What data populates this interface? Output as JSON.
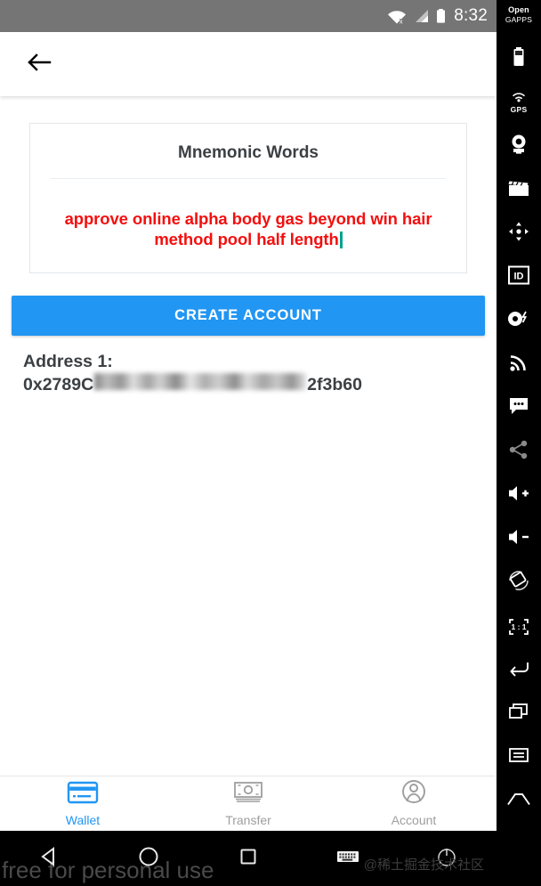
{
  "statusbar": {
    "time": "8:32",
    "icons": [
      "wifi-off-icon",
      "cellular-signal-icon",
      "battery-icon"
    ]
  },
  "appbar": {
    "back_icon": "back-arrow-icon"
  },
  "card": {
    "title": "Mnemonic Words",
    "mnemonic": "approve online alpha body gas beyond win hair method pool half length",
    "mnemonic_color": "#f40e0e",
    "caret_color": "#00a38d"
  },
  "actions": {
    "create_account_label": "CREATE ACCOUNT",
    "create_account_color": "#2196f3"
  },
  "address": {
    "label": "Address 1:",
    "prefix": "0x2789C",
    "suffix": "2f3b60",
    "redacted": true
  },
  "bottom_nav": {
    "active": "Wallet",
    "active_color": "#2196f3",
    "inactive_color": "#9e9e9e",
    "items": [
      {
        "label": "Wallet",
        "icon": "credit-card-icon"
      },
      {
        "label": "Transfer",
        "icon": "banknote-icon"
      },
      {
        "label": "Account",
        "icon": "person-circle-icon"
      }
    ]
  },
  "system_nav": {
    "items": [
      {
        "icon": "android-back-triangle-icon"
      },
      {
        "icon": "android-home-circle-icon"
      },
      {
        "icon": "android-recents-square-icon"
      },
      {
        "icon": "keyboard-icon"
      },
      {
        "icon": "power-icon"
      }
    ]
  },
  "emulator_toolbar": {
    "logo_line1": "Open",
    "logo_line2": "GAPPS",
    "ratio_label": "1 : 1",
    "gps_label": "GPS",
    "items": [
      {
        "icon": "battery-icon"
      },
      {
        "icon": "gps-icon"
      },
      {
        "icon": "camera-icon"
      },
      {
        "icon": "clapperboard-icon"
      },
      {
        "icon": "dpad-icon"
      },
      {
        "icon": "id-icon"
      },
      {
        "icon": "record-icon"
      },
      {
        "icon": "cast-icon"
      },
      {
        "icon": "chat-icon"
      },
      {
        "icon": "share-icon"
      },
      {
        "icon": "volume-up-icon"
      },
      {
        "icon": "volume-down-icon"
      },
      {
        "icon": "rotate-icon"
      },
      {
        "icon": "fullscreen-ratio-icon"
      },
      {
        "icon": "back-icon"
      },
      {
        "icon": "recents-icon"
      },
      {
        "icon": "menu-icon"
      },
      {
        "icon": "home-icon"
      }
    ]
  },
  "watermarks": {
    "left": "free for personal use",
    "right": "@稀土掘金技术社区"
  }
}
